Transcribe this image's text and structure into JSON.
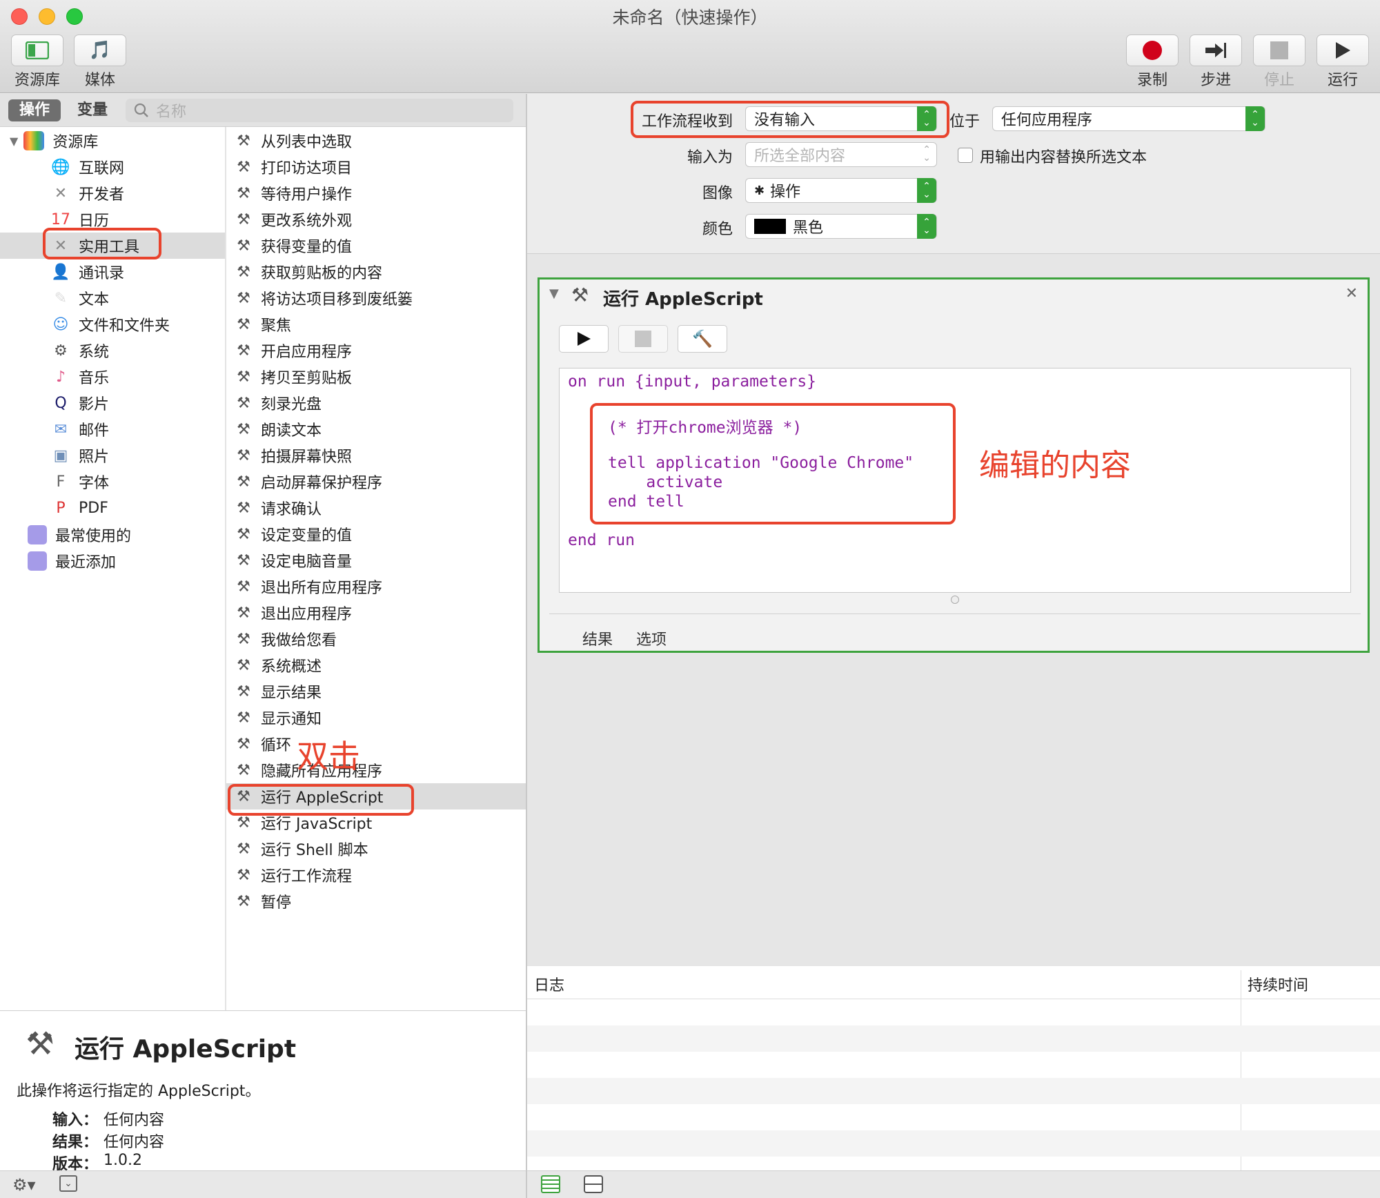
{
  "window": {
    "title": "未命名（快速操作）"
  },
  "toolbar": {
    "library_label": "资源库",
    "media_label": "媒体",
    "record_label": "录制",
    "step_label": "步进",
    "stop_label": "停止",
    "run_label": "运行"
  },
  "tabs": {
    "actions": "操作",
    "variables": "变量"
  },
  "search": {
    "placeholder": "名称"
  },
  "library": {
    "root": "资源库",
    "items": [
      {
        "label": "互联网",
        "icon": "globe-icon"
      },
      {
        "label": "开发者",
        "icon": "tools-icon"
      },
      {
        "label": "日历",
        "icon": "calendar-icon"
      },
      {
        "label": "实用工具",
        "icon": "tools-icon"
      },
      {
        "label": "通讯录",
        "icon": "contacts-icon"
      },
      {
        "label": "文本",
        "icon": "text-icon"
      },
      {
        "label": "文件和文件夹",
        "icon": "finder-icon"
      },
      {
        "label": "系统",
        "icon": "system-icon"
      },
      {
        "label": "音乐",
        "icon": "music-icon"
      },
      {
        "label": "影片",
        "icon": "movie-icon"
      },
      {
        "label": "邮件",
        "icon": "mail-icon"
      },
      {
        "label": "照片",
        "icon": "photo-icon"
      },
      {
        "label": "字体",
        "icon": "font-icon"
      },
      {
        "label": "PDF",
        "icon": "pdf-icon"
      }
    ],
    "most_used": "最常使用的",
    "recently_added": "最近添加"
  },
  "actions": [
    "从列表中选取",
    "打印访达项目",
    "等待用户操作",
    "更改系统外观",
    "获得变量的值",
    "获取剪贴板的内容",
    "将访达项目移到废纸篓",
    "聚焦",
    "开启应用程序",
    "拷贝至剪贴板",
    "刻录光盘",
    "朗读文本",
    "拍摄屏幕快照",
    "启动屏幕保护程序",
    "请求确认",
    "设定变量的值",
    "设定电脑音量",
    "退出所有应用程序",
    "退出应用程序",
    "我做给您看",
    "系统概述",
    "显示结果",
    "显示通知",
    "循环",
    "隐藏所有应用程序",
    "运行 AppleScript",
    "运行 JavaScript",
    "运行 Shell 脚本",
    "运行工作流程",
    "暂停"
  ],
  "annotations": {
    "double_click": "双击",
    "edited_content": "编辑的内容"
  },
  "description": {
    "title": "运行 AppleScript",
    "text": "此操作将运行指定的 AppleScript。",
    "input_label": "输入：",
    "input_value": "任何内容",
    "result_label": "结果：",
    "result_value": "任何内容",
    "version_label": "版本：",
    "version_value": "1.0.2"
  },
  "workflow": {
    "receives_label": "工作流程收到",
    "receives_value": "没有输入",
    "in_label": "位于",
    "in_value": "任何应用程序",
    "input_is_label": "输入为",
    "input_is_value": "所选全部内容",
    "replace_label": "用输出内容替换所选文本",
    "image_label": "图像",
    "image_value": "操作",
    "color_label": "颜色",
    "color_value": "黑色"
  },
  "action_card": {
    "title": "运行 AppleScript",
    "code_lines": [
      "on run {input, parameters}",
      "(* 打开chrome浏览器 *)",
      "tell application \"Google Chrome\"",
      "    activate",
      "end tell",
      "end run"
    ],
    "tab_results": "结果",
    "tab_options": "选项"
  },
  "log": {
    "col_log": "日志",
    "col_duration": "持续时间"
  },
  "colors": {
    "annotation_red": "#e8432d",
    "selected_green": "#3ea33e",
    "code_purple": "#8b1f9e"
  }
}
